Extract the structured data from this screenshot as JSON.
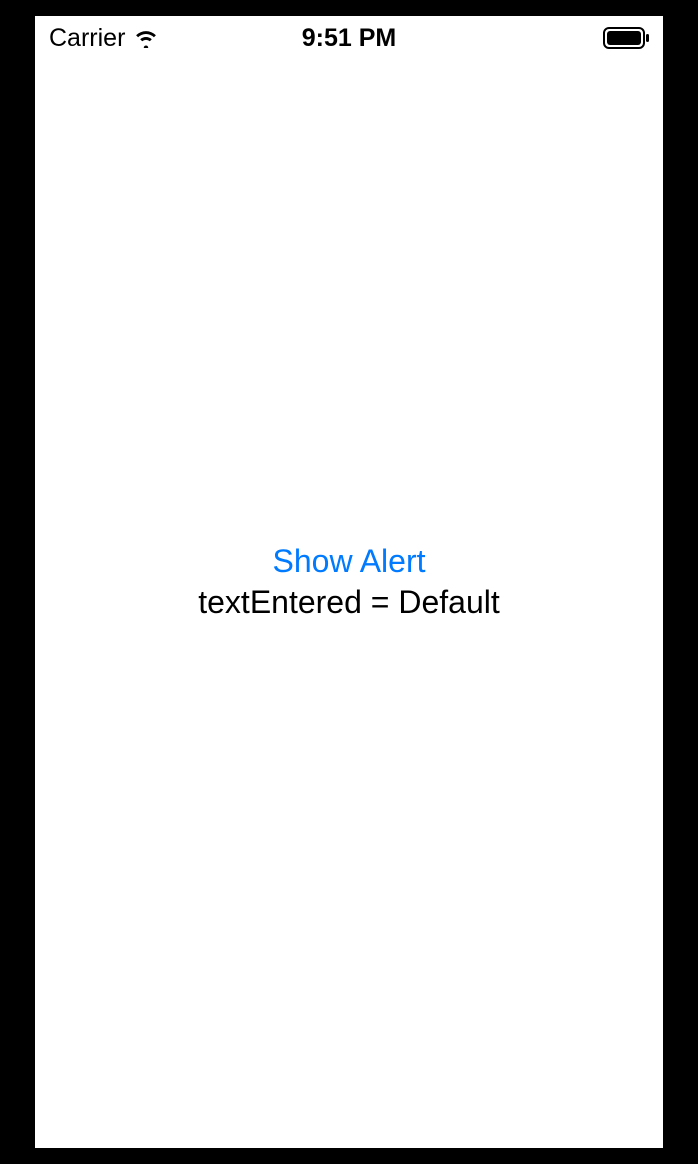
{
  "statusBar": {
    "carrier": "Carrier",
    "time": "9:51 PM"
  },
  "content": {
    "buttonLabel": "Show Alert",
    "textValue": "textEntered = Default"
  },
  "colors": {
    "link": "#007AFF",
    "text": "#000000",
    "background": "#FFFFFF"
  }
}
